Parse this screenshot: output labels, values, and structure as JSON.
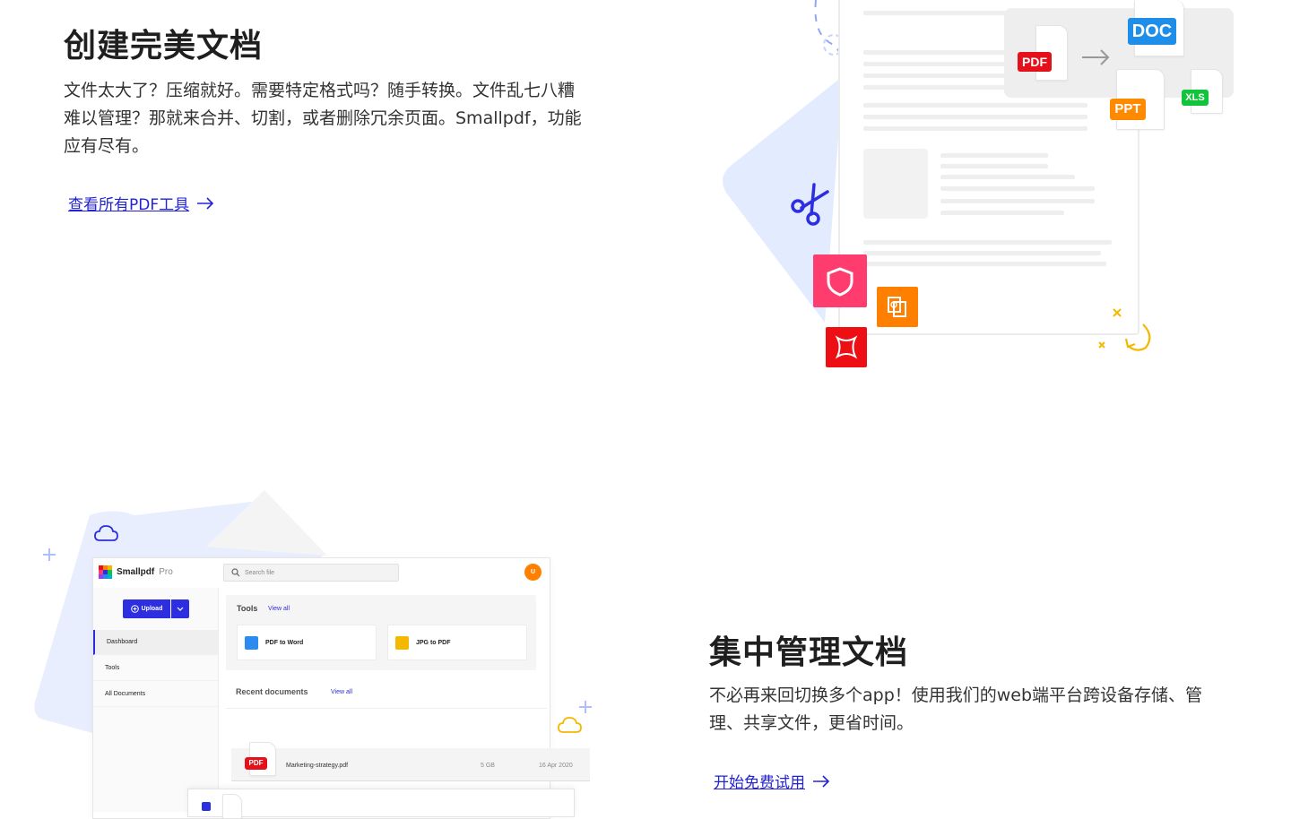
{
  "section1": {
    "title": "创建完美文档",
    "description": "文件太大了？压缩就好。需要特定格式吗？随手转换。文件乱七八糟难以管理？那就来合并、切割，或者删除冗余页面。Smallpdf，功能应有尽有。",
    "link_label": "查看所有PDF工具",
    "illustration": {
      "tags": {
        "pdf": "PDF",
        "doc": "DOC",
        "ppt": "PPT",
        "xls": "XLS"
      },
      "colors": {
        "pdf": "#e5111a",
        "doc": "#1f8ee8",
        "ppt": "#ff8a00",
        "xls": "#12c43b",
        "shield": "#ff3c6e",
        "orange": "#ff7f00",
        "red": "#ee0f14",
        "accent_blue": "#2c2ee0",
        "background_shape": "#e3ebfe"
      }
    }
  },
  "section2": {
    "title": "集中管理文档",
    "description": "不必再来回切换多个app！使用我们的web端平台跨设备存储、管理、共享文件，更省时间。",
    "link_label": "开始免费试用"
  },
  "app_mock": {
    "brand": "Smallpdf",
    "brand_suffix": "Pro",
    "search_placeholder": "Search file",
    "avatar_initial": "U",
    "upload_label": "Upload",
    "sidebar": [
      "Dashboard",
      "Tools",
      "All Documents"
    ],
    "tools_heading": "Tools",
    "tools_view_all": "View all",
    "tools": [
      {
        "name": "PDF to Word",
        "color": "#2c8bf0"
      },
      {
        "name": "JPG to PDF",
        "color": "#f5b800"
      }
    ],
    "recent_heading": "Recent documents",
    "recent_view_all": "View all",
    "rows": [
      {
        "tag": "PDF",
        "name": "Marketing-strategy.pdf",
        "size": "5 GB",
        "date": "16 Apr 2020"
      }
    ]
  }
}
